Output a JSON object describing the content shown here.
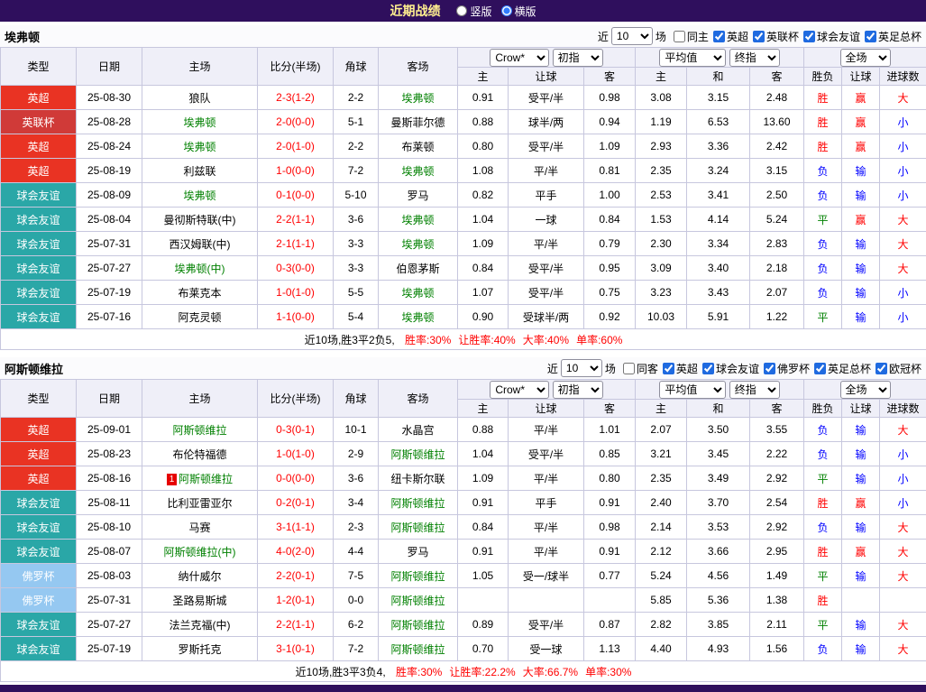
{
  "topbar": {
    "title": "近期战绩",
    "radio_vertical": "竖版",
    "radio_horizontal": "横版"
  },
  "filter_labels": {
    "recent": "近",
    "matches": "场"
  },
  "columns": {
    "type": "类型",
    "date": "日期",
    "home": "主场",
    "score": "比分(半场)",
    "corner": "角球",
    "away": "客场",
    "asia_home": "主",
    "asia_handicap": "让球",
    "asia_away": "客",
    "euro_home": "主",
    "euro_draw": "和",
    "euro_away": "客",
    "result": "胜负",
    "handicap_result": "让球",
    "goals": "进球数"
  },
  "selects": {
    "company": "Crow*",
    "asia_index": "初指",
    "euro_average": "平均值",
    "euro_index": "终指",
    "scope": "全场"
  },
  "type_colors": {
    "英超": "#e93323",
    "英联杯": "#d03a38",
    "球会友谊": "#2aa7a7",
    "佛罗杯": "#95c8f1"
  },
  "text_colors": {
    "r": "#ff0000",
    "b": "#0000ff",
    "g": "#008000"
  },
  "sections": [
    {
      "team": "埃弗顿",
      "filter": {
        "count": "10",
        "options": [
          {
            "label": "同主",
            "checked": false
          },
          {
            "label": "英超",
            "checked": true
          },
          {
            "label": "英联杯",
            "checked": true
          },
          {
            "label": "球会友谊",
            "checked": true
          },
          {
            "label": "英足总杯",
            "checked": true
          }
        ]
      },
      "rows": [
        {
          "type": "英超",
          "date": "25-08-30",
          "home": "狼队",
          "score": "2-3(1-2)",
          "corner": "2-2",
          "away": "埃弗顿",
          "away_focus": true,
          "ah": "0.91",
          "hc": "受平/半",
          "aa": "0.98",
          "eh": "3.08",
          "ed": "3.15",
          "ea": "2.48",
          "res": "胜",
          "res_c": "r",
          "hres": "赢",
          "hres_c": "r",
          "g": "大",
          "g_c": "r"
        },
        {
          "type": "英联杯",
          "date": "25-08-28",
          "home": "埃弗顿",
          "home_focus": true,
          "score": "2-0(0-0)",
          "corner": "5-1",
          "away": "曼斯菲尔德",
          "ah": "0.88",
          "hc": "球半/两",
          "aa": "0.94",
          "eh": "1.19",
          "ed": "6.53",
          "ea": "13.60",
          "res": "胜",
          "res_c": "r",
          "hres": "赢",
          "hres_c": "r",
          "g": "小",
          "g_c": "b"
        },
        {
          "type": "英超",
          "date": "25-08-24",
          "home": "埃弗顿",
          "home_focus": true,
          "score": "2-0(1-0)",
          "corner": "2-2",
          "away": "布莱顿",
          "ah": "0.80",
          "hc": "受平/半",
          "aa": "1.09",
          "eh": "2.93",
          "ed": "3.36",
          "ea": "2.42",
          "res": "胜",
          "res_c": "r",
          "hres": "赢",
          "hres_c": "r",
          "g": "小",
          "g_c": "b"
        },
        {
          "type": "英超",
          "date": "25-08-19",
          "home": "利兹联",
          "score": "1-0(0-0)",
          "corner": "7-2",
          "away": "埃弗顿",
          "away_focus": true,
          "ah": "1.08",
          "hc": "平/半",
          "aa": "0.81",
          "eh": "2.35",
          "ed": "3.24",
          "ea": "3.15",
          "res": "负",
          "res_c": "b",
          "hres": "输",
          "hres_c": "b",
          "g": "小",
          "g_c": "b"
        },
        {
          "type": "球会友谊",
          "date": "25-08-09",
          "home": "埃弗顿",
          "home_focus": true,
          "score": "0-1(0-0)",
          "corner": "5-10",
          "away": "罗马",
          "ah": "0.82",
          "hc": "平手",
          "aa": "1.00",
          "eh": "2.53",
          "ed": "3.41",
          "ea": "2.50",
          "res": "负",
          "res_c": "b",
          "hres": "输",
          "hres_c": "b",
          "g": "小",
          "g_c": "b"
        },
        {
          "type": "球会友谊",
          "date": "25-08-04",
          "home": "曼彻斯特联(中)",
          "score": "2-2(1-1)",
          "corner": "3-6",
          "away": "埃弗顿",
          "away_focus": true,
          "ah": "1.04",
          "hc": "一球",
          "aa": "0.84",
          "eh": "1.53",
          "ed": "4.14",
          "ea": "5.24",
          "res": "平",
          "res_c": "g",
          "hres": "赢",
          "hres_c": "r",
          "g": "大",
          "g_c": "r"
        },
        {
          "type": "球会友谊",
          "date": "25-07-31",
          "home": "西汉姆联(中)",
          "score": "2-1(1-1)",
          "corner": "3-3",
          "away": "埃弗顿",
          "away_focus": true,
          "ah": "1.09",
          "hc": "平/半",
          "aa": "0.79",
          "eh": "2.30",
          "ed": "3.34",
          "ea": "2.83",
          "res": "负",
          "res_c": "b",
          "hres": "输",
          "hres_c": "b",
          "g": "大",
          "g_c": "r"
        },
        {
          "type": "球会友谊",
          "date": "25-07-27",
          "home": "埃弗顿(中)",
          "home_focus": true,
          "score": "0-3(0-0)",
          "corner": "3-3",
          "away": "伯恩茅斯",
          "ah": "0.84",
          "hc": "受平/半",
          "aa": "0.95",
          "eh": "3.09",
          "ed": "3.40",
          "ea": "2.18",
          "res": "负",
          "res_c": "b",
          "hres": "输",
          "hres_c": "b",
          "g": "大",
          "g_c": "r"
        },
        {
          "type": "球会友谊",
          "date": "25-07-19",
          "home": "布莱克本",
          "score": "1-0(1-0)",
          "corner": "5-5",
          "away": "埃弗顿",
          "away_focus": true,
          "ah": "1.07",
          "hc": "受平/半",
          "aa": "0.75",
          "eh": "3.23",
          "ed": "3.43",
          "ea": "2.07",
          "res": "负",
          "res_c": "b",
          "hres": "输",
          "hres_c": "b",
          "g": "小",
          "g_c": "b"
        },
        {
          "type": "球会友谊",
          "date": "25-07-16",
          "home": "阿克灵顿",
          "score": "1-1(0-0)",
          "corner": "5-4",
          "away": "埃弗顿",
          "away_focus": true,
          "ah": "0.90",
          "hc": "受球半/两",
          "aa": "0.92",
          "eh": "10.03",
          "ed": "5.91",
          "ea": "1.22",
          "res": "平",
          "res_c": "g",
          "hres": "输",
          "hres_c": "b",
          "g": "小",
          "g_c": "b"
        }
      ],
      "summary": {
        "prefix": "近10场,胜3平2负5,",
        "stats": [
          "胜率:30%",
          "让胜率:40%",
          "大率:40%",
          "单率:60%"
        ]
      }
    },
    {
      "team": "阿斯顿维拉",
      "filter": {
        "count": "10",
        "options": [
          {
            "label": "同客",
            "checked": false
          },
          {
            "label": "英超",
            "checked": true
          },
          {
            "label": "球会友谊",
            "checked": true
          },
          {
            "label": "佛罗杯",
            "checked": true
          },
          {
            "label": "英足总杯",
            "checked": true
          },
          {
            "label": "欧冠杯",
            "checked": true
          }
        ]
      },
      "rows": [
        {
          "type": "英超",
          "date": "25-09-01",
          "home": "阿斯顿维拉",
          "home_focus": true,
          "score": "0-3(0-1)",
          "corner": "10-1",
          "away": "水晶宫",
          "ah": "0.88",
          "hc": "平/半",
          "aa": "1.01",
          "eh": "2.07",
          "ed": "3.50",
          "ea": "3.55",
          "res": "负",
          "res_c": "b",
          "hres": "输",
          "hres_c": "b",
          "g": "大",
          "g_c": "r"
        },
        {
          "type": "英超",
          "date": "25-08-23",
          "home": "布伦特福德",
          "score": "1-0(1-0)",
          "corner": "2-9",
          "away": "阿斯顿维拉",
          "away_focus": true,
          "ah": "1.04",
          "hc": "受平/半",
          "aa": "0.85",
          "eh": "3.21",
          "ed": "3.45",
          "ea": "2.22",
          "res": "负",
          "res_c": "b",
          "hres": "输",
          "hres_c": "b",
          "g": "小",
          "g_c": "b"
        },
        {
          "type": "英超",
          "date": "25-08-16",
          "home": "阿斯顿维拉",
          "home_focus": true,
          "home_badge": "1",
          "score": "0-0(0-0)",
          "corner": "3-6",
          "away": "纽卡斯尔联",
          "ah": "1.09",
          "hc": "平/半",
          "aa": "0.80",
          "eh": "2.35",
          "ed": "3.49",
          "ea": "2.92",
          "res": "平",
          "res_c": "g",
          "hres": "输",
          "hres_c": "b",
          "g": "小",
          "g_c": "b"
        },
        {
          "type": "球会友谊",
          "date": "25-08-11",
          "home": "比利亚雷亚尔",
          "score": "0-2(0-1)",
          "corner": "3-4",
          "away": "阿斯顿维拉",
          "away_focus": true,
          "ah": "0.91",
          "hc": "平手",
          "aa": "0.91",
          "eh": "2.40",
          "ed": "3.70",
          "ea": "2.54",
          "res": "胜",
          "res_c": "r",
          "hres": "赢",
          "hres_c": "r",
          "g": "小",
          "g_c": "b"
        },
        {
          "type": "球会友谊",
          "date": "25-08-10",
          "home": "马赛",
          "score": "3-1(1-1)",
          "corner": "2-3",
          "away": "阿斯顿维拉",
          "away_focus": true,
          "ah": "0.84",
          "hc": "平/半",
          "aa": "0.98",
          "eh": "2.14",
          "ed": "3.53",
          "ea": "2.92",
          "res": "负",
          "res_c": "b",
          "hres": "输",
          "hres_c": "b",
          "g": "大",
          "g_c": "r"
        },
        {
          "type": "球会友谊",
          "date": "25-08-07",
          "home": "阿斯顿维拉(中)",
          "home_focus": true,
          "score": "4-0(2-0)",
          "corner": "4-4",
          "away": "罗马",
          "ah": "0.91",
          "hc": "平/半",
          "aa": "0.91",
          "eh": "2.12",
          "ed": "3.66",
          "ea": "2.95",
          "res": "胜",
          "res_c": "r",
          "hres": "赢",
          "hres_c": "r",
          "g": "大",
          "g_c": "r"
        },
        {
          "type": "佛罗杯",
          "date": "25-08-03",
          "home": "纳什威尔",
          "score": "2-2(0-1)",
          "corner": "7-5",
          "away": "阿斯顿维拉",
          "away_focus": true,
          "ah": "1.05",
          "hc": "受一/球半",
          "aa": "0.77",
          "eh": "5.24",
          "ed": "4.56",
          "ea": "1.49",
          "res": "平",
          "res_c": "g",
          "hres": "输",
          "hres_c": "b",
          "g": "大",
          "g_c": "r"
        },
        {
          "type": "佛罗杯",
          "date": "25-07-31",
          "home": "圣路易斯城",
          "score": "1-2(0-1)",
          "corner": "0-0",
          "away": "阿斯顿维拉",
          "away_focus": true,
          "ah": "",
          "hc": "",
          "aa": "",
          "eh": "5.85",
          "ed": "5.36",
          "ea": "1.38",
          "res": "胜",
          "res_c": "r",
          "hres": "",
          "g": ""
        },
        {
          "type": "球会友谊",
          "date": "25-07-27",
          "home": "法兰克福(中)",
          "score": "2-2(1-1)",
          "corner": "6-2",
          "away": "阿斯顿维拉",
          "away_focus": true,
          "ah": "0.89",
          "hc": "受平/半",
          "aa": "0.87",
          "eh": "2.82",
          "ed": "3.85",
          "ea": "2.11",
          "res": "平",
          "res_c": "g",
          "hres": "输",
          "hres_c": "b",
          "g": "大",
          "g_c": "r"
        },
        {
          "type": "球会友谊",
          "date": "25-07-19",
          "home": "罗斯托克",
          "score": "3-1(0-1)",
          "corner": "7-2",
          "away": "阿斯顿维拉",
          "away_focus": true,
          "ah": "0.70",
          "hc": "受一球",
          "aa": "1.13",
          "eh": "4.40",
          "ed": "4.93",
          "ea": "1.56",
          "res": "负",
          "res_c": "b",
          "hres": "输",
          "hres_c": "b",
          "g": "大",
          "g_c": "r"
        }
      ],
      "summary": {
        "prefix": "近10场,胜3平3负4,",
        "stats": [
          "胜率:30%",
          "让胜率:22.2%",
          "大率:66.7%",
          "单率:30%"
        ]
      }
    }
  ]
}
